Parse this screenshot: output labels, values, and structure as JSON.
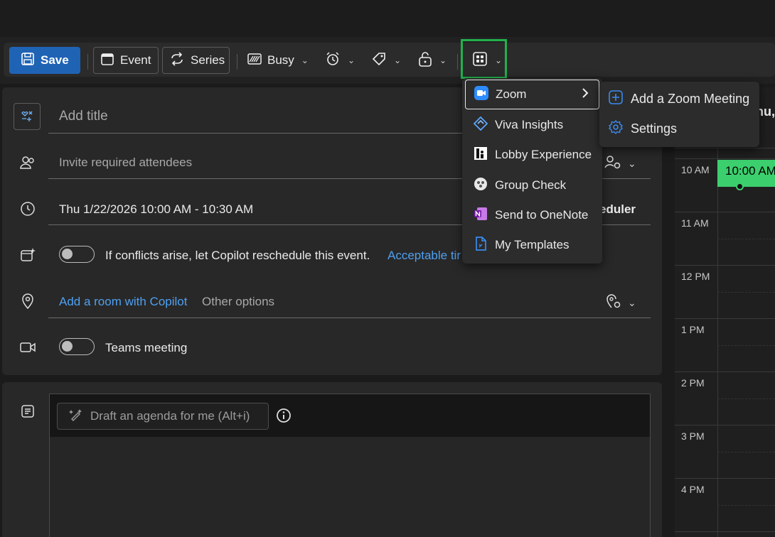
{
  "toolbar": {
    "save_label": "Save",
    "event_label": "Event",
    "series_label": "Series",
    "show_as_label": "Busy"
  },
  "form": {
    "title_placeholder": "Add title",
    "attendees_placeholder": "Invite required attendees",
    "datetime_value": "Thu 1/22/2026 10:00 AM - 10:30 AM",
    "scheduler_label": "eduler",
    "copilot_reschedule_text": "If conflicts arise, let Copilot reschedule this event.",
    "acceptable_times_link": "Acceptable tir",
    "add_room_link": "Add a room with Copilot",
    "other_options_text": "Other options",
    "teams_meeting_label": "Teams meeting"
  },
  "body": {
    "draft_agenda_label": "Draft an agenda for me (Alt+i)"
  },
  "apps_menu": {
    "items": [
      {
        "label": "Zoom",
        "icon": "zoom-icon",
        "has_submenu": true
      },
      {
        "label": "Viva Insights",
        "icon": "viva-insights-icon"
      },
      {
        "label": "Lobby Experience",
        "icon": "lobby-experience-icon"
      },
      {
        "label": "Group Check",
        "icon": "group-check-icon"
      },
      {
        "label": "Send to OneNote",
        "icon": "onenote-icon"
      },
      {
        "label": "My Templates",
        "icon": "templates-icon"
      }
    ]
  },
  "zoom_submenu": {
    "items": [
      {
        "label": "Add a Zoom Meeting",
        "icon": "add-icon"
      },
      {
        "label": "Settings",
        "icon": "gear-icon"
      }
    ]
  },
  "calendar": {
    "header_partial": "hu,",
    "hours": [
      "10 AM",
      "11 AM",
      "12 PM",
      "1 PM",
      "2 PM",
      "3 PM",
      "4 PM"
    ],
    "event_label": "10:00 AM"
  },
  "colors": {
    "accent": "#1f63b5",
    "link": "#4ea0f1",
    "event": "#3ccf6e",
    "highlight": "#21b14c"
  }
}
